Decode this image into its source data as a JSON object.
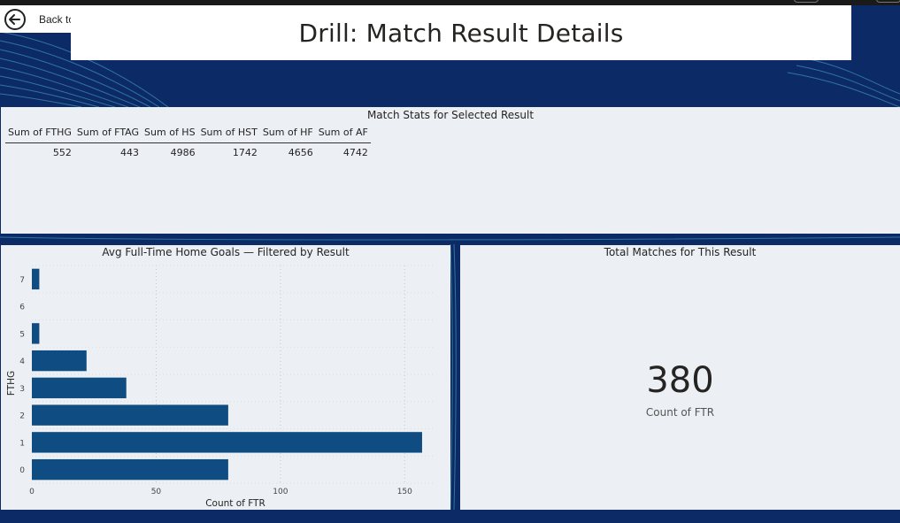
{
  "navigation": {
    "back_label": "Back to Summary"
  },
  "page_title": "Drill: Match Result Details",
  "stats_table": {
    "title": "Match Stats for Selected Result",
    "columns": [
      "Sum of FTHG",
      "Sum of FTAG",
      "Sum of HS",
      "Sum of HST",
      "Sum of HF",
      "Sum of AF"
    ],
    "row": [
      "552",
      "443",
      "4986",
      "1742",
      "4656",
      "4742"
    ]
  },
  "kpi_card": {
    "title": "Total Matches for This Result",
    "value": "380",
    "label": "Count of FTR"
  },
  "chart_data": {
    "type": "bar",
    "orientation": "horizontal",
    "title": "Avg Full-Time Home Goals — Filtered by Result",
    "xlabel": "Count of FTR",
    "ylabel": "FTHG",
    "categories": [
      "0",
      "1",
      "2",
      "3",
      "4",
      "5",
      "6",
      "7"
    ],
    "values": [
      79,
      157,
      79,
      38,
      22,
      3,
      0,
      3
    ],
    "xlim": [
      0,
      162
    ],
    "xticks": [
      "0",
      "50",
      "100",
      "150"
    ],
    "xtick_values": [
      0,
      50,
      100,
      150
    ],
    "grid": true,
    "bar_color": "#0f4c81"
  },
  "colors": {
    "background": "#0b2a66",
    "panel": "#f5f7f9",
    "accent": "#5fc4d6"
  }
}
